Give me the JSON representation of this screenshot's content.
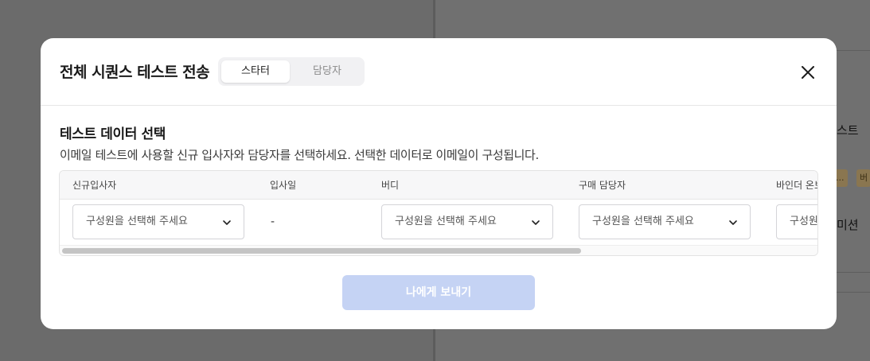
{
  "background": {
    "right_text_1": "스트",
    "right_chip_1": "...",
    "right_chip_2": "버",
    "right_text_2": "미션"
  },
  "modal": {
    "title": "전체 시퀀스 테스트 전송",
    "tabs": [
      {
        "label": "스타터",
        "active": true
      },
      {
        "label": "담당자",
        "active": false
      }
    ],
    "close_icon": "close-icon",
    "section_title": "테스트 데이터 선택",
    "section_desc": "이메일 테스트에 사용할 신규 입사자와 담당자를 선택하세요. 선택한 데이터로 이메일이 구성됩니다.",
    "table": {
      "headers": [
        "신규입사자",
        "입사일",
        "버디",
        "구매 담당자",
        "바인더 온보"
      ],
      "row": {
        "new_hire_placeholder": "구성원을 선택해 주세요",
        "hire_date": "-",
        "buddy_placeholder": "구성원을 선택해 주세요",
        "purchase_manager_placeholder": "구성원을 선택해 주세요",
        "binder_placeholder": "구성원을 선택해 주세요"
      },
      "scroll_fraction_visible": 0.69
    },
    "send_button": "나에게 보내기"
  },
  "colors": {
    "primary_disabled": "#c5d3f4",
    "overlay": "#6b6b6b",
    "chip": "#8a7650"
  }
}
